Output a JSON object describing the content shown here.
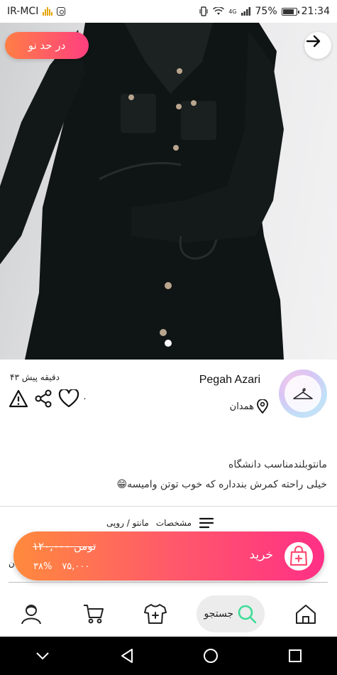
{
  "status_bar": {
    "carrier": "IR-MCI",
    "signal_type": "4G",
    "battery": "75%",
    "time": "21:34"
  },
  "product": {
    "condition_tag": "در حد نو",
    "time_ago": "۴۳ دقیقه پیش",
    "like_count": "۰",
    "seller_name": "Pegah Azari",
    "seller_location": "همدان",
    "description_line1": "مانتوبلندمناسب دانشگاه",
    "description_line2": "خیلی راحته کمرش بندداره که خوب توتن وامیسه😁",
    "specs_label": "مشخصات",
    "specs_value": "مانتو / روپی",
    "side_text": "ن"
  },
  "buy_bar": {
    "old_price": "۱۲۰,۰۰۰ تومن",
    "discount": "۳۸%",
    "new_price": "۷۵,۰۰۰",
    "buy_label": "خرید"
  },
  "bottom_nav": {
    "search_label": "جستجو"
  },
  "colors": {
    "accent_orange": "#ff8a3d",
    "accent_pink": "#ff2f86",
    "search_green": "#3ddc97"
  }
}
